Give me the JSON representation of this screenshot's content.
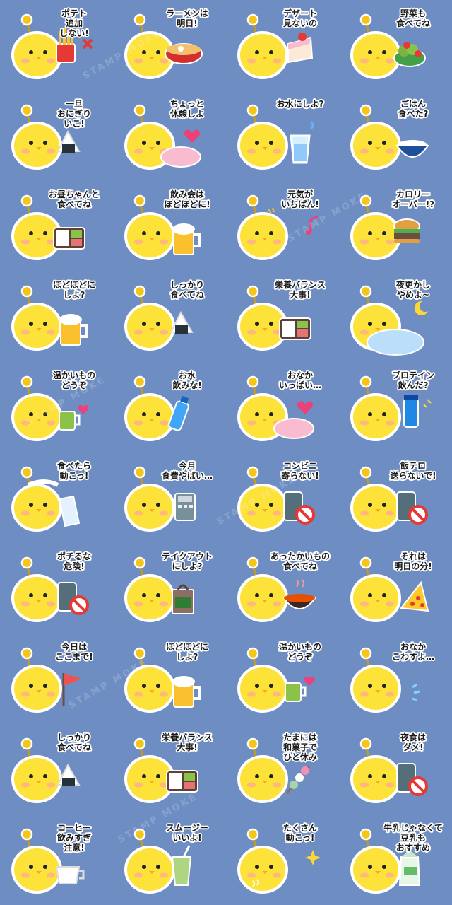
{
  "watermark": "STAMP MOKE",
  "colors": {
    "background": "#6e8ec3",
    "chick": "#fde23a",
    "outline": "#ffffff"
  },
  "stickers": [
    {
      "text": "ポテト\n追加\nしない!",
      "prop": "fries-icon"
    },
    {
      "text": "ラーメンは\n明日!",
      "prop": "ramen-icon"
    },
    {
      "text": "デザート\n見ないの",
      "prop": "cake-icon"
    },
    {
      "text": "野菜も\n食べてね",
      "prop": "salad-icon"
    },
    {
      "text": "一旦\nおにぎり\nいこ!",
      "prop": "onigiri-icon"
    },
    {
      "text": "ちょっと\n休憩しよ",
      "prop": "heart-icon"
    },
    {
      "text": "お水にしよ?",
      "prop": "water-glass-icon"
    },
    {
      "text": "ごはん\n食べた?",
      "prop": "rice-bowl-icon"
    },
    {
      "text": "お昼ちゃんと\n食べてね",
      "prop": "bento-icon"
    },
    {
      "text": "飲み会は\nほどほどに!",
      "prop": "beer-icon"
    },
    {
      "text": "元気が\nいちばん!",
      "prop": "music-note-icon"
    },
    {
      "text": "カロリー\nオーバー!?",
      "prop": "burger-icon"
    },
    {
      "text": "ほどほどに\nしよ?",
      "prop": "beer-icon"
    },
    {
      "text": "しっかり\n食べてね",
      "prop": "onigiri-icon"
    },
    {
      "text": "栄養バランス\n大事!",
      "prop": "bento-icon"
    },
    {
      "text": "夜更かし\nやめよ~",
      "prop": "moon-icon"
    },
    {
      "text": "温かいもの\nどうぞ",
      "prop": "cup-icon"
    },
    {
      "text": "お水\n飲みな!",
      "prop": "water-bottle-icon"
    },
    {
      "text": "おなか\nいっぱい…",
      "prop": "heart-icon"
    },
    {
      "text": "プロテイン\n飲んだ?",
      "prop": "shaker-icon"
    },
    {
      "text": "食べたら\n動こっ!",
      "prop": "towel-icon"
    },
    {
      "text": "今月\n食費やばい…",
      "prop": "calculator-icon"
    },
    {
      "text": "コンビニ\n寄らない!",
      "prop": "no-sign-icon"
    },
    {
      "text": "飯テロ\n送らないで!",
      "prop": "no-sign-icon"
    },
    {
      "text": "ポチるな\n危険!",
      "prop": "no-sign-icon"
    },
    {
      "text": "テイクアウト\nにしよ?",
      "prop": "takeout-bag-icon"
    },
    {
      "text": "あったかいもの\n食べてね",
      "prop": "soup-bowl-icon"
    },
    {
      "text": "それは\n明日の分!",
      "prop": "pizza-icon"
    },
    {
      "text": "今日は\nここまで!",
      "prop": "flag-icon"
    },
    {
      "text": "ほどほどに\nしよ?",
      "prop": "beer-icon"
    },
    {
      "text": "温かいもの\nどうぞ",
      "prop": "cup-icon"
    },
    {
      "text": "おなか\nこわすよ…",
      "prop": "sweat-icon"
    },
    {
      "text": "しっかり\n食べてね",
      "prop": "onigiri-icon"
    },
    {
      "text": "栄養バランス\n大事!",
      "prop": "bento-icon"
    },
    {
      "text": "たまには\n和菓子で\nひと休み",
      "prop": "dango-icon"
    },
    {
      "text": "夜食は\nダメ!",
      "prop": "no-sign-icon"
    },
    {
      "text": "コーヒー\n飲みすぎ\n注意!",
      "prop": "coffee-cup-icon"
    },
    {
      "text": "スムージー\nいいよ!",
      "prop": "smoothie-icon"
    },
    {
      "text": "たくさん\n動こっ!",
      "prop": "sparkle-icon"
    },
    {
      "text": "牛乳じゃなくて\n豆乳も\nおすすめ",
      "prop": "soy-milk-icon"
    }
  ]
}
